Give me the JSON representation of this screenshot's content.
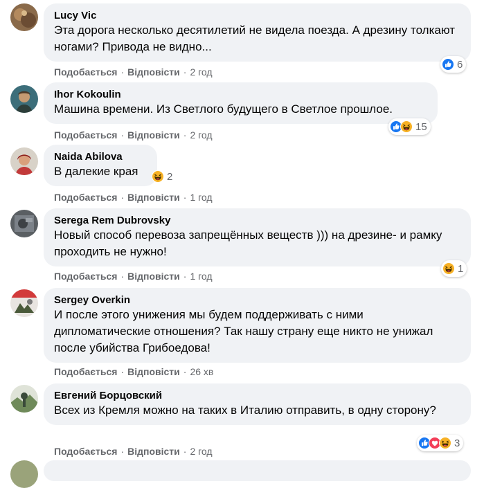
{
  "comments": [
    {
      "author": "Lucy Vic",
      "text": "Эта дорога несколько десятилетий не видела поезда. А дрезину толкают ногами? Привода не видно...",
      "like_label": "Подобається",
      "reply_label": "Відповісти",
      "time": "2 год",
      "reactions": [
        "like-icon"
      ],
      "reaction_count": "6"
    },
    {
      "author": "Ihor Kokoulin",
      "text": "Машина времени. Из Светлого будущего в Светлое прошлое.",
      "like_label": "Подобається",
      "reply_label": "Відповісти",
      "time": "2 год",
      "reactions": [
        "like-icon",
        "haha-icon"
      ],
      "reaction_count": "15"
    },
    {
      "author": "Naida Abilova",
      "text": "В далекие края",
      "like_label": "Подобається",
      "reply_label": "Відповісти",
      "time": "1 год",
      "reactions": [
        "haha-icon"
      ],
      "reaction_count": "2"
    },
    {
      "author": "Serega Rem Dubrovsky",
      "text": "Новый способ перевоза запрещённых веществ ))) на дрезине- и рамку проходить не нужно!",
      "like_label": "Подобається",
      "reply_label": "Відповісти",
      "time": "1 год",
      "reactions": [
        "haha-icon"
      ],
      "reaction_count": "1"
    },
    {
      "author": "Sergey Overkin",
      "text": "И после этого унижения мы будем поддерживать с ними дипломатические отношения? Так нашу страну еще никто не унижал после убийства Грибоедова!",
      "like_label": "Подобається",
      "reply_label": "Відповісти",
      "time": "26 хв",
      "reactions": [],
      "reaction_count": ""
    },
    {
      "author": "Евгений Борцовский",
      "text": "Всех из Кремля можно на таких в Италию отправить, в одну сторону?",
      "like_label": "Подобається",
      "reply_label": "Відповісти",
      "time": "2 год",
      "reactions": [
        "like-icon",
        "love-icon",
        "haha-icon"
      ],
      "reaction_count": "3"
    }
  ],
  "separator": "·",
  "colors": {
    "bubble": "#f0f2f5",
    "meta_text": "#65676b",
    "like_blue": "#1877f2",
    "love_red": "#f33e58",
    "haha_yellow": "#f7b125"
  }
}
